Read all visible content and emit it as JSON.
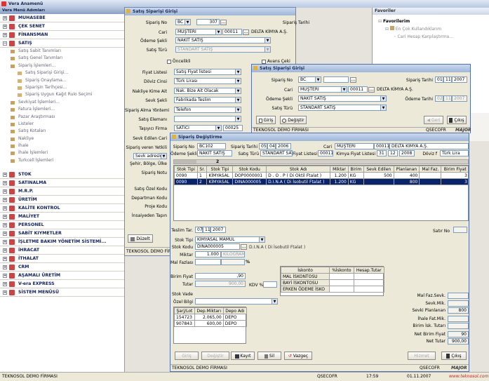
{
  "app": {
    "title": "Vera Anamenü"
  },
  "sidebar": {
    "title": "Vera Menü Adımları",
    "top_items": [
      "MUHASEBE",
      "ÇEK SENET",
      "FİNANSMAN",
      "SATIŞ"
    ],
    "satis_items": [
      "Satış Sabit Tanımları",
      "Satış Genel Tanımları",
      "Sipariş İşlemleri..."
    ],
    "siparis_items": [
      "Satış Siparişi Girişi...",
      "Sipariş Onaylama...",
      "Siparişin Tarihçesi...",
      "Sipariş Uygun Kağıt Rulo Seçimi"
    ],
    "satis_items2": [
      "Sevkiyat İşlemleri...",
      "Fatura İşlemleri...",
      "Pazar Araştırması",
      "Listeler",
      "Satış Kotaları",
      "Nakliye",
      "İhale",
      "İhale İşlemleri",
      "Turkcell İşlemleri"
    ],
    "bottom_items": [
      "STOK",
      "SATINALMA",
      "M.R.P.",
      "ÜRETİM",
      "KALİTE KONTROL",
      "MALİYET",
      "PERSONEL",
      "SABİT KIYMETLER",
      "İŞLETME BAKIM YÖNETİM SİSTEMİ...",
      "İHRACAT",
      "İTHALAT",
      "CRM",
      "AŞAMALI ÜRETİM",
      "V-era EXPRESS",
      "SİSTEM MENÜSÜ"
    ]
  },
  "favorites": {
    "title": "Favoriler",
    "header": "Favorilerim",
    "items": [
      "En Çok Kullandıklarım",
      "Cari Hesap Karşılaştırma..."
    ]
  },
  "win1": {
    "title": "Satış Siparişi Girişi",
    "siparis_no_label": "Sipariş No",
    "siparis_no_prefix": "BC",
    "siparis_no": "307",
    "siparis_tarihi_label": "Sipariş Tarihi",
    "siparis_tarihi": [
      "01",
      "11",
      "2007"
    ],
    "cari_label": "Cari",
    "cari_type": "MÜŞTERİ",
    "cari_no": "00011",
    "cari_name": "DELTA KİMYA A.Ş.",
    "odeme_sekli_label": "Ödeme Şekli",
    "odeme_sekli": "NAKİT SATIŞ",
    "odeme_tarihi_label": "Ödeme Tarihi",
    "odeme_tarihi": [
      "02",
      "11",
      "2007"
    ],
    "satis_turu_label": "Satış Türü",
    "satis_turu": "STANDART SATIŞ",
    "oncelikli": "Öncelikli",
    "avans_cek": "Avans Çeki",
    "labels": [
      "Fiyat Listesi",
      "Döviz Cinsi",
      "Nakliye Kime Ait",
      "Sevk Şekli",
      "Sipariş Alma Yöntemi",
      "Satış Elemanı",
      "Taşıyıcı Firma",
      "Sevk Edilen Cari",
      "Sipariş veren Yetkili"
    ],
    "values": [
      "Satış Fiyat listesi",
      "Türk Lirası",
      "Nak. Bize Ait Olacak",
      "Fabrikada Teslim",
      "Telefon",
      "",
      "SATICI",
      "",
      ""
    ],
    "tasiyici_no": "00025",
    "sevk_adres": "Sevk adresler",
    "labels2": [
      "Şehir, Bölge, Ülke",
      "Sipariş Notu",
      "Satış Özel Kodu",
      "Departman Kodu",
      "Proje Kodu",
      "İnsaiyeden Tapın"
    ],
    "btn_duzelt": "Düzelt",
    "status": "TEKNOSOL DEMO FİRMASI"
  },
  "win2": {
    "title": "Satış Siparişi Girişi",
    "siparis_no_label": "Sipariş No",
    "siparis_no_prefix": "BC",
    "siparis_tarihi_label": "Sipariş Tarihi",
    "siparis_tarihi": [
      "01",
      "11",
      "2007"
    ],
    "cari_label": "Cari",
    "cari_type": "MÜŞTERİ",
    "cari_no": "00011",
    "cari_name": "DELTA KİMYA A.Ş.",
    "odeme_sekli_label": "Ödeme Şekli",
    "odeme_sekli": "NAKİT SATIŞ",
    "odeme_tarihi_label": "Ödeme Tarihi",
    "odeme_tarihi": [
      "02",
      "11",
      "2007"
    ],
    "satis_turu_label": "Satış Türü",
    "satis_turu": "STANDART SATIŞ",
    "btn_giris": "Giriş",
    "btn_degistir": "Değiştir",
    "btn_geri": "Geri",
    "btn_cikis": "Çıkış",
    "status_left": "TEKNOSOL DEMO FİRMASI",
    "status_right": "QSECOFR",
    "logo": "MAJOR"
  },
  "win3": {
    "title": "Sipariş Değiştirme",
    "hdr": {
      "siparis_no_label": "Sipariş No",
      "siparis_no": "BC102",
      "siparis_tarihi_label": "Sipariş Tarihi",
      "siparis_tarihi": [
        "05",
        "04",
        "2006"
      ],
      "cari_label": "Cari",
      "cari_type": "MÜŞTERİ",
      "cari_no": "00011",
      "cari_name": "DELTA KİMYA A.Ş.",
      "odeme_label": "Ödeme Şekli",
      "odeme": "NAKİT SATIŞ",
      "satis_turu_label": "Satış Türü",
      "satis_turu": "STANDART SAT",
      "fiyat_listesi_label": "Fiyat Listesi",
      "fiyat_listesi": "00011",
      "kimya_label": "Kimya Fiyat Listesi",
      "kimya_no": "31",
      "kimya_month": "12",
      "kimya_year": "2008",
      "doviz_label": "Döviz f",
      "doviz": "Türk Lira"
    },
    "counter": "2",
    "columns": [
      "Stok Tipi",
      "Sr.",
      "Stok Tipi",
      "Stok Kodu",
      "Stok Adı",
      "Miktar",
      "Birim",
      "Sevk Edilen",
      "Planlanan",
      "Mal Faz.",
      "Birim Fiyat"
    ],
    "rows": [
      [
        "0090",
        "1",
        "KİMYASAL",
        "DOP0000001",
        "D . O . P ( Di Oktil Ftalat )",
        "1.200",
        "KG",
        "500",
        "400",
        "",
        "3"
      ],
      [
        "0090",
        "2",
        "KİMYASAL",
        "DINA000005",
        "D.I.N.A ( Di İsobutil Ftalat )",
        "1.200",
        "KG",
        "",
        "800",
        "",
        "3"
      ]
    ],
    "teslim_label": "Teslim Tar.",
    "teslim": [
      "07",
      "11",
      "2007"
    ],
    "satir_no_label": "Satır No",
    "stok_tipi_label": "Stok Tipi",
    "stok_tipi": "KİMYASAL MAMUL",
    "stok_kodu_label": "Stok Kodu",
    "stok_kodu": "DINA000005",
    "stok_kodu_desc": "D.I.N.A ( Di İsobutil Ftalat )",
    "miktar_label": "Miktar",
    "miktar": "1.000",
    "miktar_unit": "KILOGRAM",
    "mal_fazlasi_label": "Mal Fazlası",
    "percent": "%",
    "iskonto_cols": [
      "İskonto",
      "%İskonto",
      "Hesap.Tutar"
    ],
    "iskonto_rows": [
      "MAL İSKONTOSU",
      "BAYİ İSKONTOSU",
      "ERKEN ÖDEME İSKO"
    ],
    "birim_fiyat_label": "Birim Fiyat",
    "birim_fiyat": ",90",
    "tutar_label": "Tutar",
    "tutar": "900,00",
    "kdv_label": "KDV %",
    "stok_vade_label": "Stok Vade",
    "ozel_bilgi_label": "Özel Bilgi",
    "lot_cols": [
      "Şarj/Lot",
      "Dep.Miktarı",
      "Depo Adı"
    ],
    "lot_rows": [
      [
        "154723",
        "2.065,00",
        "DEPO"
      ],
      [
        "907843",
        "600,00",
        "DEPO"
      ]
    ],
    "summary_labels": [
      "Mal Faz.Sevk.",
      "Sevk.Mik.",
      "Sevki Planlanan",
      "İhale Fat.Mik.",
      "Birim İsk. Tutarı",
      "Net Birim Fiyat",
      "Net Tutar"
    ],
    "summary_values": [
      "",
      "",
      "800",
      "",
      "",
      "90",
      "900,00"
    ],
    "btns": [
      "Giriş",
      "Değiştir",
      "Kayıt",
      "Sil",
      "Vazgeç",
      "Hizmet",
      "Çıkış"
    ],
    "status_left": "TEKNOSOL DEMO FİRMASI",
    "status_right": "QSECOFR",
    "logo": "MAJOR"
  },
  "statusbar": {
    "company": "TEKNOSOL DEMO FİRMASI",
    "user": "QSECOFR",
    "time": "17:59",
    "date": "01.11.2007",
    "url": "www.teknosol.com"
  }
}
